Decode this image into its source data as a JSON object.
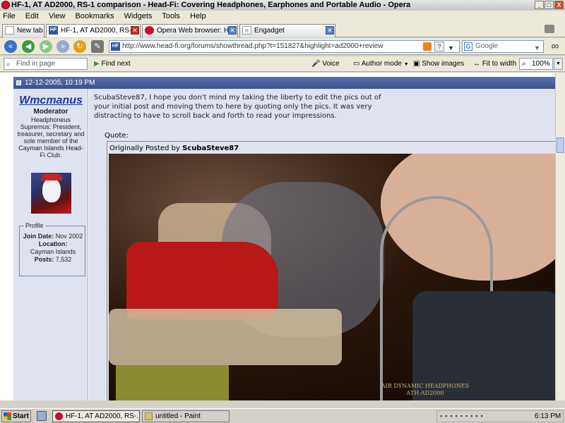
{
  "window": {
    "title": "HF-1, AT AD2000, RS-1 comparison - Head-Fi: Covering Headphones, Earphones and Portable Audio - Opera",
    "buttons": [
      "_",
      "□",
      "X"
    ]
  },
  "menu": [
    "File",
    "Edit",
    "View",
    "Bookmarks",
    "Widgets",
    "Tools",
    "Help"
  ],
  "tabs": [
    {
      "label": "New tab"
    },
    {
      "label": "HF-1, AT AD2000, RS-1 ..."
    },
    {
      "label": "Opera Web browser: Ho..."
    },
    {
      "label": "Engadget"
    }
  ],
  "address": {
    "url": "http://www.head-fi.org/forums/showthread.php?t=151827&highlight=ad2000+review",
    "site_badge": "HF"
  },
  "search": {
    "placeholder": "Google"
  },
  "findbar": {
    "find_placeholder": "Find in page",
    "find_next": "Find next",
    "voice": "Voice",
    "author_mode": "Author mode",
    "show_images": "Show images",
    "fit_to_width": "Fit to width",
    "zoom": "100%"
  },
  "post": {
    "date": "12-12-2005, 10:19 PM",
    "text": "ScubaSteve87, I hope you don't mind my taking the liberty to edit the pics out of your initial post and moving them to here by quoting only the pics. It was very distracting to have to scroll back and forth to read your impressions.",
    "quote_label": "Quote:",
    "quote_prefix": "Originally Posted by",
    "quote_author": "ScubaSteve87"
  },
  "user": {
    "name": "Wmcmanus",
    "rank": "Moderator",
    "title_lines": "Headphoneus Supremus: President, treasurer, secretary and sole member of the Cayman Islands Head-Fi Club.",
    "profile_label": "Profile",
    "join_date_label": "Join Date:",
    "join_date": "Nov 2002",
    "location_label": "Location:",
    "location": "Cayman Islands",
    "posts_label": "Posts:",
    "posts": "7,532"
  },
  "photo": {
    "headphone_text": "AIR DYNAMIC HEADPHONES",
    "headphone_model": "ATH-AD2000"
  },
  "taskbar": {
    "start": "Start",
    "items": [
      "HF-1, AT AD2000, RS-...",
      "untitled - Paint"
    ],
    "clock": "6:13 PM"
  }
}
